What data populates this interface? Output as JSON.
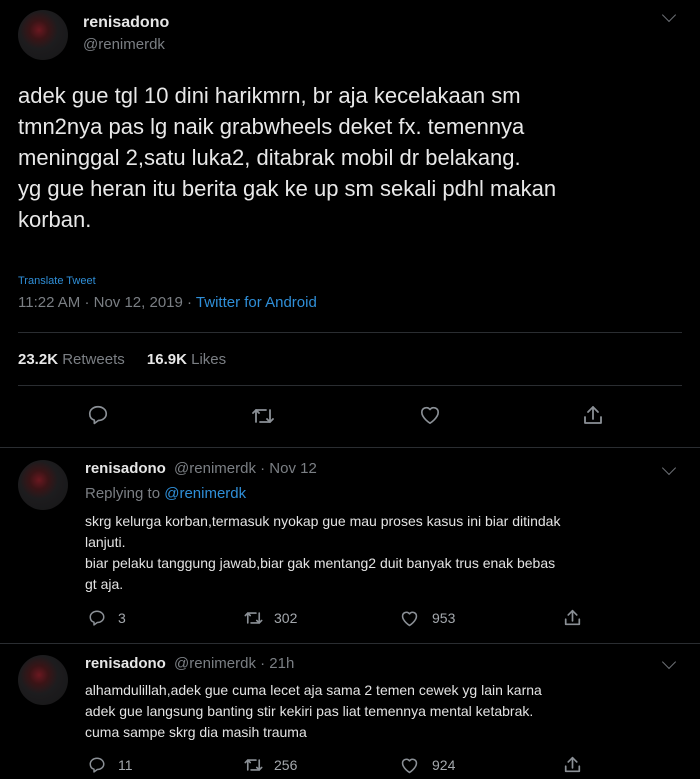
{
  "tweet": {
    "display_name": "renisadono",
    "handle": "@renimerdk",
    "text_lines": [
      "adek gue tgl 10 dini harikmrn, br aja kecelakaan sm",
      "tmn2nya pas lg naik grabwheels deket fx. temennya",
      "meninggal 2,satu luka2, ditabrak mobil dr belakang.",
      "yg gue heran itu berita gak ke up sm sekali pdhl makan",
      "korban."
    ],
    "translate_label": "Translate Tweet",
    "time": "11:22 AM",
    "date": "Nov 12, 2019",
    "separator": "·",
    "source": "Twitter for Android",
    "retweets_count": "23.2K",
    "retweets_label": "Retweets",
    "likes_count": "16.9K",
    "likes_label": "Likes"
  },
  "replies": [
    {
      "display_name": "renisadono",
      "handle": "@renimerdk",
      "time": "· Nov 12",
      "replying_prefix": "Replying to",
      "replying_to": "@renimerdk",
      "lines": [
        "skrg kelurga korban,termasuk nyokap gue mau proses kasus ini biar ditindak",
        "lanjuti.",
        "biar pelaku tanggung jawab,biar gak mentang2 duit banyak trus enak bebas",
        "gt aja."
      ],
      "reply_count": "3",
      "retweet_count": "302",
      "like_count": "953"
    },
    {
      "display_name": "renisadono",
      "handle": "@renimerdk",
      "time": "· 21h",
      "lines": [
        "alhamdulillah,adek gue cuma lecet aja sama 2 temen cewek yg lain karna",
        "adek gue langsung banting stir kekiri pas liat temennya mental ketabrak.",
        "cuma sampe skrg dia masih trauma"
      ],
      "reply_count": "11",
      "retweet_count": "256",
      "like_count": "924"
    }
  ],
  "icons": [
    "reply-icon",
    "retweet-icon",
    "like-icon",
    "share-icon",
    "chevron-down-icon"
  ],
  "colors": {
    "background": "#000000",
    "link": "#2f8fd8",
    "muted": "#7b7f84"
  }
}
